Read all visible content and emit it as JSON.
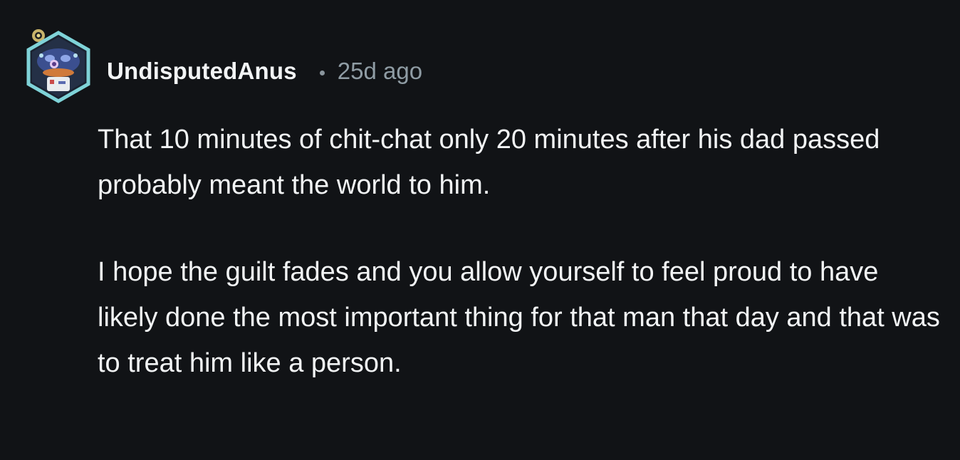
{
  "comment": {
    "username": "UndisputedAnus",
    "separator": "•",
    "timestamp": "25d ago",
    "paragraphs": [
      "That 10 minutes of chit-chat only 20 minutes after his dad passed probably meant the world to him.",
      "I hope the guilt fades and you allow yourself to feel proud to have likely done the most important thing for that man that day and that was to treat him like a person."
    ]
  },
  "colors": {
    "background": "#111316",
    "text": "#f2f4f5",
    "muted": "#8f9ca4",
    "avatar_frame": "#7fd3d8"
  },
  "icons": {
    "avatar": "user-avatar-icon",
    "badge": "flair-badge-icon"
  }
}
